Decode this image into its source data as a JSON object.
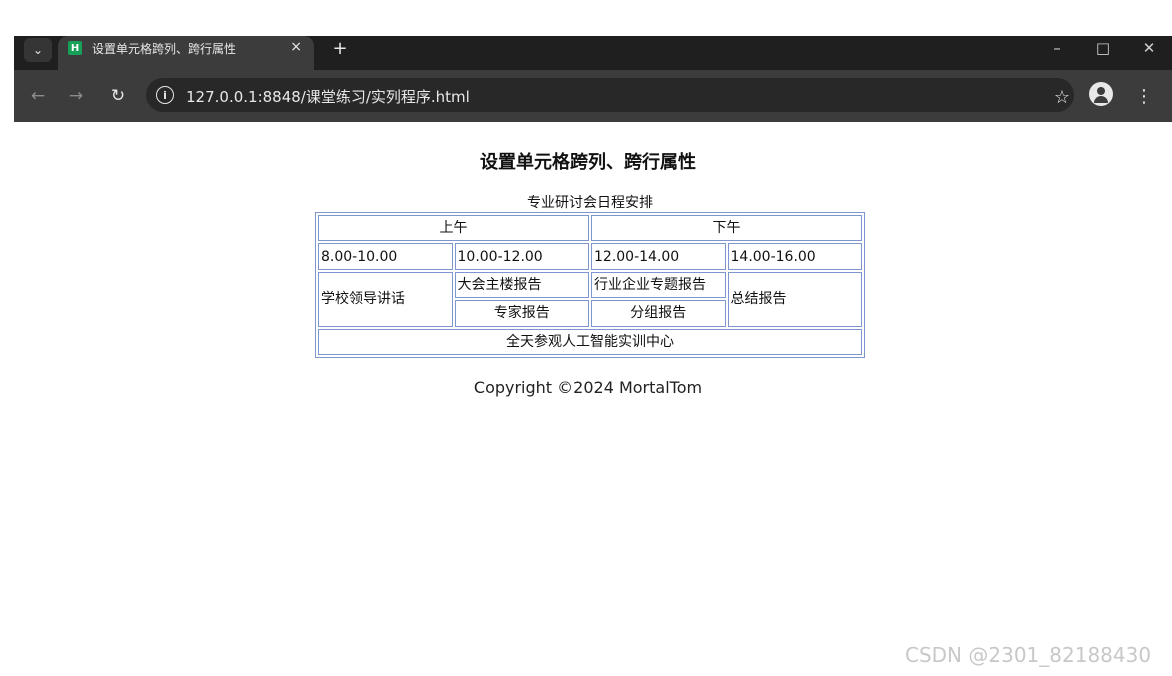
{
  "browser": {
    "tab_title": "设置单元格跨列、跨行属性",
    "favicon_letter": "H",
    "url": "127.0.0.1:8848/课堂练习/实列程序.html"
  },
  "page": {
    "title": "设置单元格跨列、跨行属性",
    "table_caption": "专业研讨会日程安排",
    "table": {
      "morning": "上午",
      "afternoon": "下午",
      "times": [
        "8.00-10.00",
        "10.00-12.00",
        "12.00-14.00",
        "14.00-16.00"
      ],
      "leader_speech": "学校领导讲话",
      "conference_report": "大会主楼报告",
      "industry_report": "行业企业专题报告",
      "summary_report": "总结报告",
      "expert_report": "专家报告",
      "group_report": "分组报告",
      "visit_all_day": "全天参观人工智能实训中心"
    },
    "copyright": "Copyright ©2024 MortalTom"
  },
  "watermark": "CSDN @2301_82188430"
}
